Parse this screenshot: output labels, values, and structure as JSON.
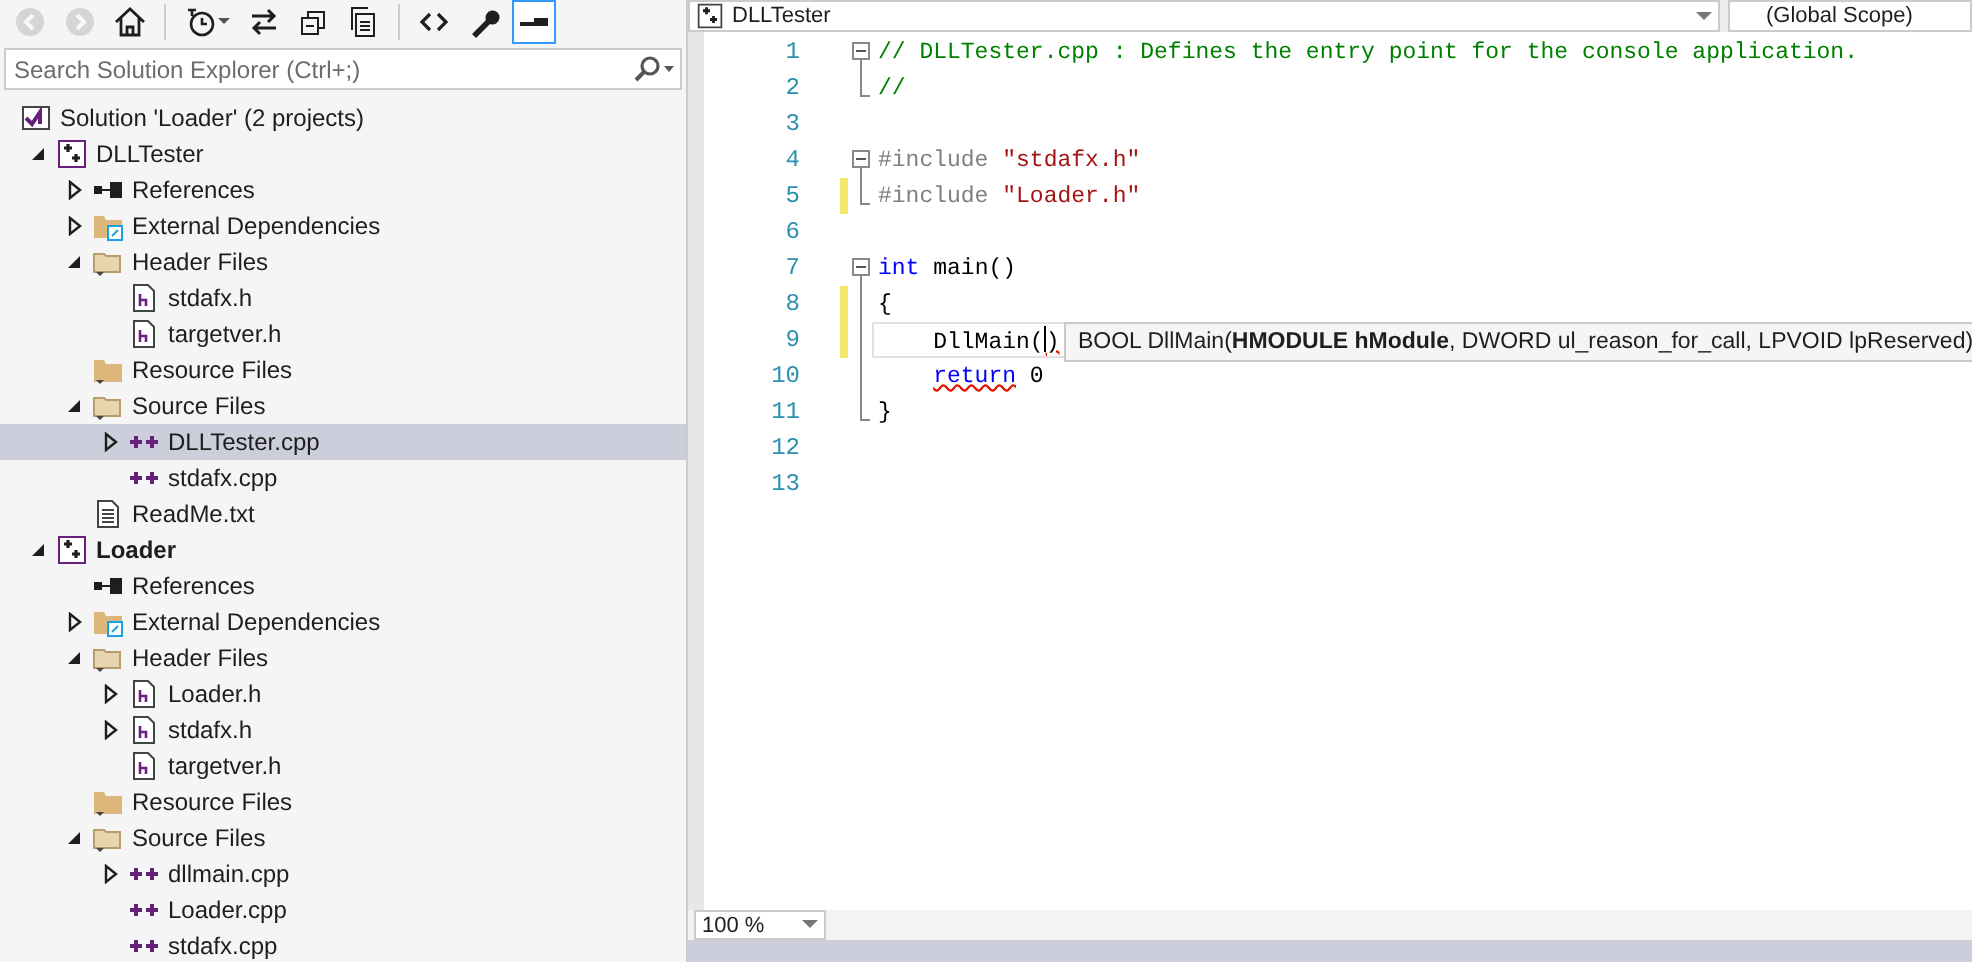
{
  "solution_explorer": {
    "toolbar": [
      {
        "kind": "back",
        "disabled": true,
        "selected": false
      },
      {
        "kind": "forward",
        "disabled": true,
        "selected": false
      },
      {
        "kind": "home",
        "disabled": false,
        "selected": false
      },
      {
        "kind": "history",
        "disabled": false,
        "selected": false
      },
      {
        "kind": "sync",
        "disabled": false,
        "selected": false
      },
      {
        "kind": "collapse",
        "disabled": false,
        "selected": false
      },
      {
        "kind": "showall",
        "disabled": false,
        "selected": false
      },
      {
        "kind": "code",
        "disabled": false,
        "selected": false
      },
      {
        "kind": "properties",
        "disabled": false,
        "selected": false
      },
      {
        "kind": "preview",
        "disabled": false,
        "selected": true
      }
    ],
    "search": {
      "placeholder": "Search Solution Explorer (Ctrl+;)"
    },
    "tree": [
      {
        "label": "Solution 'Loader' (2 projects)",
        "kind": "solution",
        "selected": false,
        "children": [
          {
            "label": "DLLTester",
            "kind": "project",
            "expanded": true,
            "bold": false,
            "selected": false,
            "children": [
              {
                "label": "References",
                "kind": "references",
                "expanded": false,
                "selected": false
              },
              {
                "label": "External Dependencies",
                "kind": "external",
                "expanded": false,
                "selected": false
              },
              {
                "label": "Header Files",
                "kind": "filter",
                "expanded": true,
                "selected": false,
                "children": [
                  {
                    "label": "stdafx.h",
                    "kind": "header",
                    "selected": false
                  },
                  {
                    "label": "targetver.h",
                    "kind": "header",
                    "selected": false
                  }
                ]
              },
              {
                "label": "Resource Files",
                "kind": "emptyfilter",
                "selected": false
              },
              {
                "label": "Source Files",
                "kind": "filter",
                "expanded": true,
                "selected": false,
                "children": [
                  {
                    "label": "DLLTester.cpp",
                    "kind": "cpp",
                    "expanded": false,
                    "selected": true
                  },
                  {
                    "label": "stdafx.cpp",
                    "kind": "cpp",
                    "selected": false
                  }
                ]
              },
              {
                "label": "ReadMe.txt",
                "kind": "text",
                "selected": false
              }
            ]
          },
          {
            "label": "Loader",
            "kind": "project",
            "expanded": true,
            "bold": true,
            "selected": false,
            "children": [
              {
                "label": "References",
                "kind": "references",
                "selected": false
              },
              {
                "label": "External Dependencies",
                "kind": "external",
                "expanded": false,
                "selected": false
              },
              {
                "label": "Header Files",
                "kind": "filter",
                "expanded": true,
                "selected": false,
                "children": [
                  {
                    "label": "Loader.h",
                    "kind": "header",
                    "expanded": false,
                    "selected": false
                  },
                  {
                    "label": "stdafx.h",
                    "kind": "header",
                    "expanded": false,
                    "selected": false
                  },
                  {
                    "label": "targetver.h",
                    "kind": "header",
                    "selected": false
                  }
                ]
              },
              {
                "label": "Resource Files",
                "kind": "emptyfilter",
                "selected": false
              },
              {
                "label": "Source Files",
                "kind": "filter",
                "expanded": true,
                "selected": false,
                "children": [
                  {
                    "label": "dllmain.cpp",
                    "kind": "cpp",
                    "expanded": false,
                    "selected": false
                  },
                  {
                    "label": "Loader.cpp",
                    "kind": "cpp",
                    "selected": false
                  },
                  {
                    "label": "stdafx.cpp",
                    "kind": "cpp",
                    "selected": false
                  }
                ]
              }
            ]
          }
        ]
      }
    ]
  },
  "editor": {
    "project_dropdown": "DLLTester",
    "scope_dropdown": "(Global Scope)",
    "lines": [
      {
        "number": "1",
        "kind": "open",
        "changed": false,
        "current": false,
        "tokens": [
          {
            "t": "// DLLTester.cpp : Defines the entry point for the console application.",
            "kind": "comment"
          }
        ]
      },
      {
        "number": "2",
        "kind": "close",
        "changed": false,
        "current": false,
        "tokens": [
          {
            "t": "//",
            "kind": "comment"
          }
        ]
      },
      {
        "number": "3",
        "kind": "plain",
        "changed": false,
        "current": false
      },
      {
        "number": "4",
        "kind": "open",
        "changed": false,
        "current": false,
        "tokens": [
          {
            "t": "#include",
            "kind": "preprocessor"
          },
          {
            "t": " \"stdafx.h\"",
            "kind": "string"
          }
        ]
      },
      {
        "number": "5",
        "kind": "close",
        "changed": true,
        "current": false,
        "tokens": [
          {
            "t": "#include",
            "kind": "preprocessor"
          },
          {
            "t": " \"Loader.h\"",
            "kind": "string"
          }
        ]
      },
      {
        "number": "6",
        "kind": "plain",
        "changed": false,
        "current": false
      },
      {
        "number": "7",
        "kind": "open",
        "changed": false,
        "current": false,
        "tokens": [
          {
            "t": "int",
            "kind": "keyword"
          },
          {
            "t": " main()",
            "kind": "plain"
          }
        ]
      },
      {
        "number": "8",
        "kind": "inside",
        "changed": true,
        "current": false,
        "tokens": [
          {
            "t": "{",
            "kind": "plain"
          }
        ]
      },
      {
        "number": "9",
        "kind": "inside",
        "changed": true,
        "current": true,
        "indented": true,
        "tokens": [
          {
            "t": "DllMain(",
            "kind": "plain"
          },
          {
            "t": ")",
            "kind": "plain",
            "caret_before": true,
            "squiggle": true
          }
        ]
      },
      {
        "number": "10",
        "kind": "inside",
        "changed": false,
        "current": false,
        "indented": true,
        "tokens": [
          {
            "t": "return",
            "kind": "keyword",
            "squiggle": true
          },
          {
            "t": " 0",
            "kind": "plain"
          }
        ]
      },
      {
        "number": "11",
        "kind": "close",
        "changed": false,
        "current": false,
        "tokens": [
          {
            "t": "}",
            "kind": "plain"
          }
        ]
      },
      {
        "number": "12",
        "kind": "plain",
        "changed": false,
        "current": false
      },
      {
        "number": "13",
        "kind": "plain",
        "changed": false,
        "current": false
      }
    ],
    "tooltip": "BOOL DllMain(**HMODULE hModule**, DWORD ul_reason_for_call, LPVOID lpReserved)",
    "zoom": "100 %"
  }
}
